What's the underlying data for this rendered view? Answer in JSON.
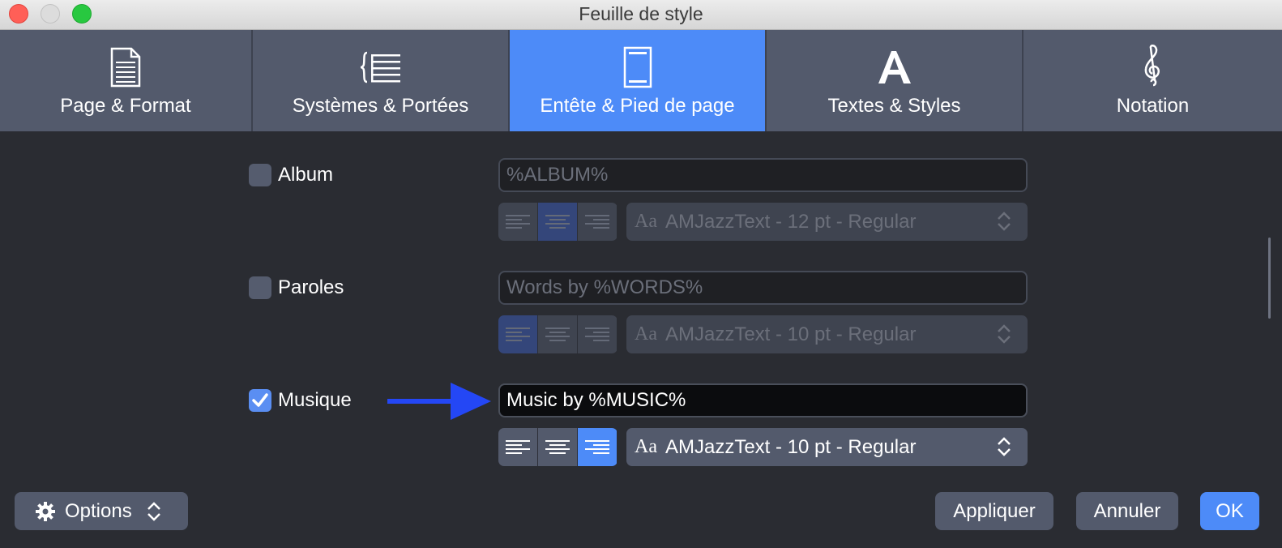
{
  "window": {
    "title": "Feuille de style"
  },
  "tabs": [
    {
      "label": "Page & Format",
      "icon": "page-icon"
    },
    {
      "label": "Systèmes & Portées",
      "icon": "systems-icon"
    },
    {
      "label": "Entête & Pied de page",
      "icon": "header-footer-icon",
      "active": true
    },
    {
      "label": "Textes & Styles",
      "icon": "text-style-icon"
    },
    {
      "label": "Notation",
      "icon": "treble-clef-icon"
    }
  ],
  "sections": {
    "album": {
      "label": "Album",
      "checked": false,
      "value": "%ALBUM%",
      "font_aa": "Aa",
      "font": "AMJazzText - 12 pt - Regular",
      "alignment": "center"
    },
    "paroles": {
      "label": "Paroles",
      "checked": false,
      "value": "Words by %WORDS%",
      "font_aa": "Aa",
      "font": "AMJazzText - 10 pt - Regular",
      "alignment": "left"
    },
    "musique": {
      "label": "Musique",
      "checked": true,
      "value": "Music by %MUSIC%",
      "font_aa": "Aa",
      "font": "AMJazzText - 10 pt - Regular",
      "alignment": "right"
    }
  },
  "footer": {
    "options_label": "Options",
    "apply_label": "Appliquer",
    "cancel_label": "Annuler",
    "ok_label": "OK"
  },
  "colors": {
    "accent": "#4d8bf8",
    "arrow": "#2447f5",
    "background": "#2a2c32",
    "tabbar": "#535a6c"
  }
}
